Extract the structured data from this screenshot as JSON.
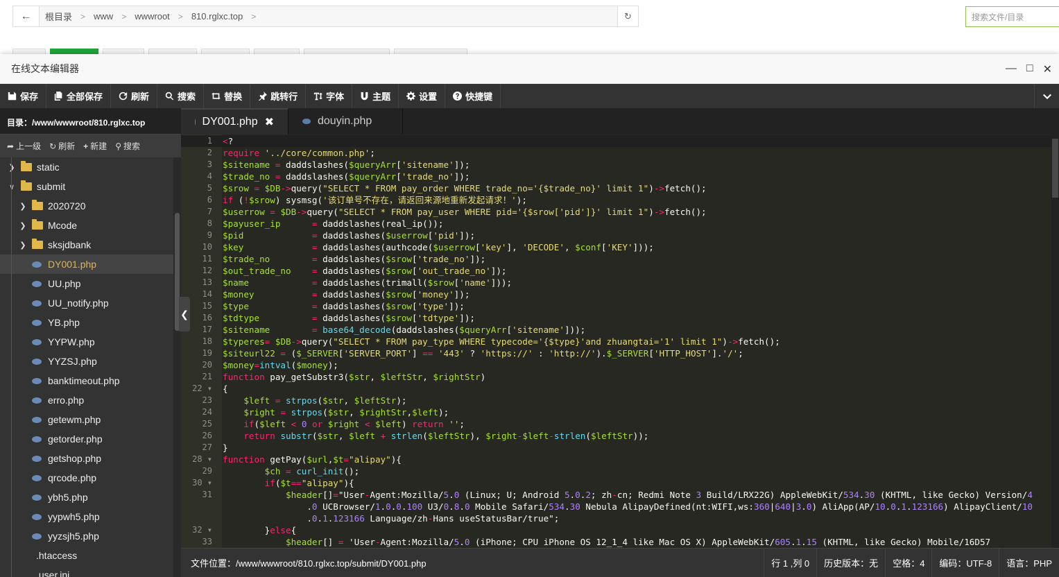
{
  "address_bar": {
    "segments": [
      "根目录",
      "www",
      "wwwroot",
      "810.rglxc.top"
    ],
    "search_placeholder": "搜索文件/目录"
  },
  "dialog": {
    "title": "在线文本编辑器"
  },
  "toolbar": {
    "save": "保存",
    "save_all": "全部保存",
    "refresh": "刷新",
    "search": "搜索",
    "replace": "替换",
    "goto_line": "跳转行",
    "font": "字体",
    "theme": "主题",
    "settings": "设置",
    "shortcuts": "快捷键"
  },
  "sidebar": {
    "dir_label": "目录：/www/wwwroot/810.rglxc.top",
    "up": "上一级",
    "refresh": "刷新",
    "new": "新建",
    "search": "搜索",
    "tree": [
      {
        "label": "static",
        "type": "folder",
        "expanded": false,
        "depth": 0
      },
      {
        "label": "submit",
        "type": "folder",
        "expanded": true,
        "depth": 0
      },
      {
        "label": "2020720",
        "type": "folder",
        "expanded": false,
        "depth": 1
      },
      {
        "label": "Mcode",
        "type": "folder",
        "expanded": false,
        "depth": 1
      },
      {
        "label": "sksjdbank",
        "type": "folder",
        "expanded": false,
        "depth": 1
      },
      {
        "label": "DY001.php",
        "type": "php",
        "selected": true,
        "depth": 1
      },
      {
        "label": "UU.php",
        "type": "php",
        "depth": 1
      },
      {
        "label": "UU_notify.php",
        "type": "php",
        "depth": 1
      },
      {
        "label": "YB.php",
        "type": "php",
        "depth": 1
      },
      {
        "label": "YYPW.php",
        "type": "php",
        "depth": 1
      },
      {
        "label": "YYZSJ.php",
        "type": "php",
        "depth": 1
      },
      {
        "label": "banktimeout.php",
        "type": "php",
        "depth": 1
      },
      {
        "label": "erro.php",
        "type": "php",
        "depth": 1
      },
      {
        "label": "getewm.php",
        "type": "php",
        "depth": 1
      },
      {
        "label": "getorder.php",
        "type": "php",
        "depth": 1
      },
      {
        "label": "getshop.php",
        "type": "php",
        "depth": 1
      },
      {
        "label": "qrcode.php",
        "type": "php",
        "depth": 1
      },
      {
        "label": "ybh5.php",
        "type": "php",
        "depth": 1
      },
      {
        "label": "yypwh5.php",
        "type": "php",
        "depth": 1
      },
      {
        "label": "yyzsjh5.php",
        "type": "php",
        "depth": 1
      },
      {
        "label": ".htaccess",
        "type": "plain",
        "depth": 1
      },
      {
        "label": ".user.ini",
        "type": "plain",
        "depth": 1
      }
    ]
  },
  "tabs": [
    {
      "label": "DY001.php",
      "active": true
    },
    {
      "label": "douyin.php",
      "active": false
    }
  ],
  "code_lines": [
    {
      "n": "1",
      "text": "<?"
    },
    {
      "n": "2",
      "text": "require '../core/common.php';"
    },
    {
      "n": "3",
      "text": "$sitename = daddslashes($queryArr['sitename']);"
    },
    {
      "n": "4",
      "text": "$trade_no = daddslashes($queryArr['trade_no']);"
    },
    {
      "n": "5",
      "text": "$srow = $DB->query(\"SELECT * FROM pay_order WHERE trade_no='{$trade_no}' limit 1\")->fetch();"
    },
    {
      "n": "6",
      "text": "if (!$srow) sysmsg('该订单号不存在，请返回来源地重新发起请求！');"
    },
    {
      "n": "7",
      "text": "$userrow = $DB->query(\"SELECT * FROM pay_user WHERE pid='{$srow['pid']}' limit 1\")->fetch();"
    },
    {
      "n": "8",
      "text": "$payuser_ip      = daddslashes(real_ip());"
    },
    {
      "n": "9",
      "text": "$pid             = daddslashes($userrow['pid']);"
    },
    {
      "n": "10",
      "text": "$key             = daddslashes(authcode($userrow['key'], 'DECODE', $conf['KEY']));"
    },
    {
      "n": "11",
      "text": "$trade_no        = daddslashes($srow['trade_no']);"
    },
    {
      "n": "12",
      "text": "$out_trade_no    = daddslashes($srow['out_trade_no']);"
    },
    {
      "n": "13",
      "text": "$name            = daddslashes(trimall($srow['name']));"
    },
    {
      "n": "14",
      "text": "$money           = daddslashes($srow['money']);"
    },
    {
      "n": "15",
      "text": "$type            = daddslashes($srow['type']);"
    },
    {
      "n": "16",
      "text": "$tdtype          = daddslashes($srow['tdtype']);"
    },
    {
      "n": "17",
      "text": "$sitename        = base64_decode(daddslashes($queryArr['sitename']));"
    },
    {
      "n": "18",
      "text": "$typeres= $DB->query(\"SELECT * FROM pay_type WHERE typecode='{$type}'and zhuangtai='1' limit 1\")->fetch();"
    },
    {
      "n": "19",
      "text": "$siteurl22 = ($_SERVER['SERVER_PORT'] == '443' ? 'https://' : 'http://').$_SERVER['HTTP_HOST'].'/';"
    },
    {
      "n": "20",
      "text": "$money=intval($money);"
    },
    {
      "n": "21",
      "text": "function pay_getSubstr3($str, $leftStr, $rightStr)"
    },
    {
      "n": "22 ▾",
      "text": "{"
    },
    {
      "n": "23",
      "text": "    $left = strpos($str, $leftStr);"
    },
    {
      "n": "24",
      "text": "    $right = strpos($str, $rightStr,$left);"
    },
    {
      "n": "25",
      "text": "    if($left < 0 or $right < $left) return '';"
    },
    {
      "n": "26",
      "text": "    return substr($str, $left + strlen($leftStr), $right-$left-strlen($leftStr));"
    },
    {
      "n": "27",
      "text": "}"
    },
    {
      "n": "28 ▾",
      "text": "function getPay($url,$t=\"alipay\"){"
    },
    {
      "n": "29",
      "text": "        $ch = curl_init();"
    },
    {
      "n": "30 ▾",
      "text": "        if($t==\"alipay\"){"
    },
    {
      "n": "31",
      "text": "            $header[]=\"User-Agent:Mozilla/5.0 (Linux; U; Android 5.0.2; zh-cn; Redmi Note 3 Build/LRX22G) AppleWebKit/534.30 (KHTML, like Gecko) Version/4"
    },
    {
      "n": "",
      "text": "                .0 UCBrowser/1.0.0.100 U3/0.8.0 Mobile Safari/534.30 Nebula AlipayDefined(nt:WIFI,ws:360|640|3.0) AliApp(AP/10.0.1.123166) AlipayClient/10"
    },
    {
      "n": "",
      "text": "                .0.1.123166 Language/zh-Hans useStatusBar/true\";"
    },
    {
      "n": "32 ▾",
      "text": "        }else{"
    },
    {
      "n": "33",
      "text": "            $header[] = 'User-Agent:Mozilla/5.0 (iPhone; CPU iPhone OS 12_1_4 like Mac OS X) AppleWebKit/605.1.15 (KHTML, like Gecko) Mobile/16D57"
    }
  ],
  "status": {
    "path": "文件位置：/www/wwwroot/810.rglxc.top/submit/DY001.php",
    "cursor": "行 1 ,列 0",
    "history": "历史版本：无",
    "indent": "空格：4",
    "encoding": "编码：UTF-8",
    "language": "语言：PHP"
  },
  "colors": {
    "toolbar_bg": "#333333",
    "editor_bg": "#272822",
    "keyword": "#f92672",
    "string": "#e6db74",
    "variable": "#a6e22e",
    "builtin": "#66d9ef",
    "number": "#ae81ff",
    "folder": "#e0b84a",
    "accent_green": "#20a53a"
  }
}
